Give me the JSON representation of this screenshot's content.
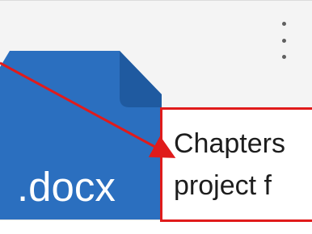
{
  "file_card": {
    "extension_label": ".docx",
    "icon": "docx-file-icon",
    "more_icon": "more-vertical-icon",
    "colors": {
      "icon_blue": "#2b6fbf",
      "icon_fold": "#1f5aa0",
      "card_bg": "#f4f4f4"
    }
  },
  "annotation": {
    "text": "Chapters\nproject f",
    "border_color": "#e01b1b"
  }
}
